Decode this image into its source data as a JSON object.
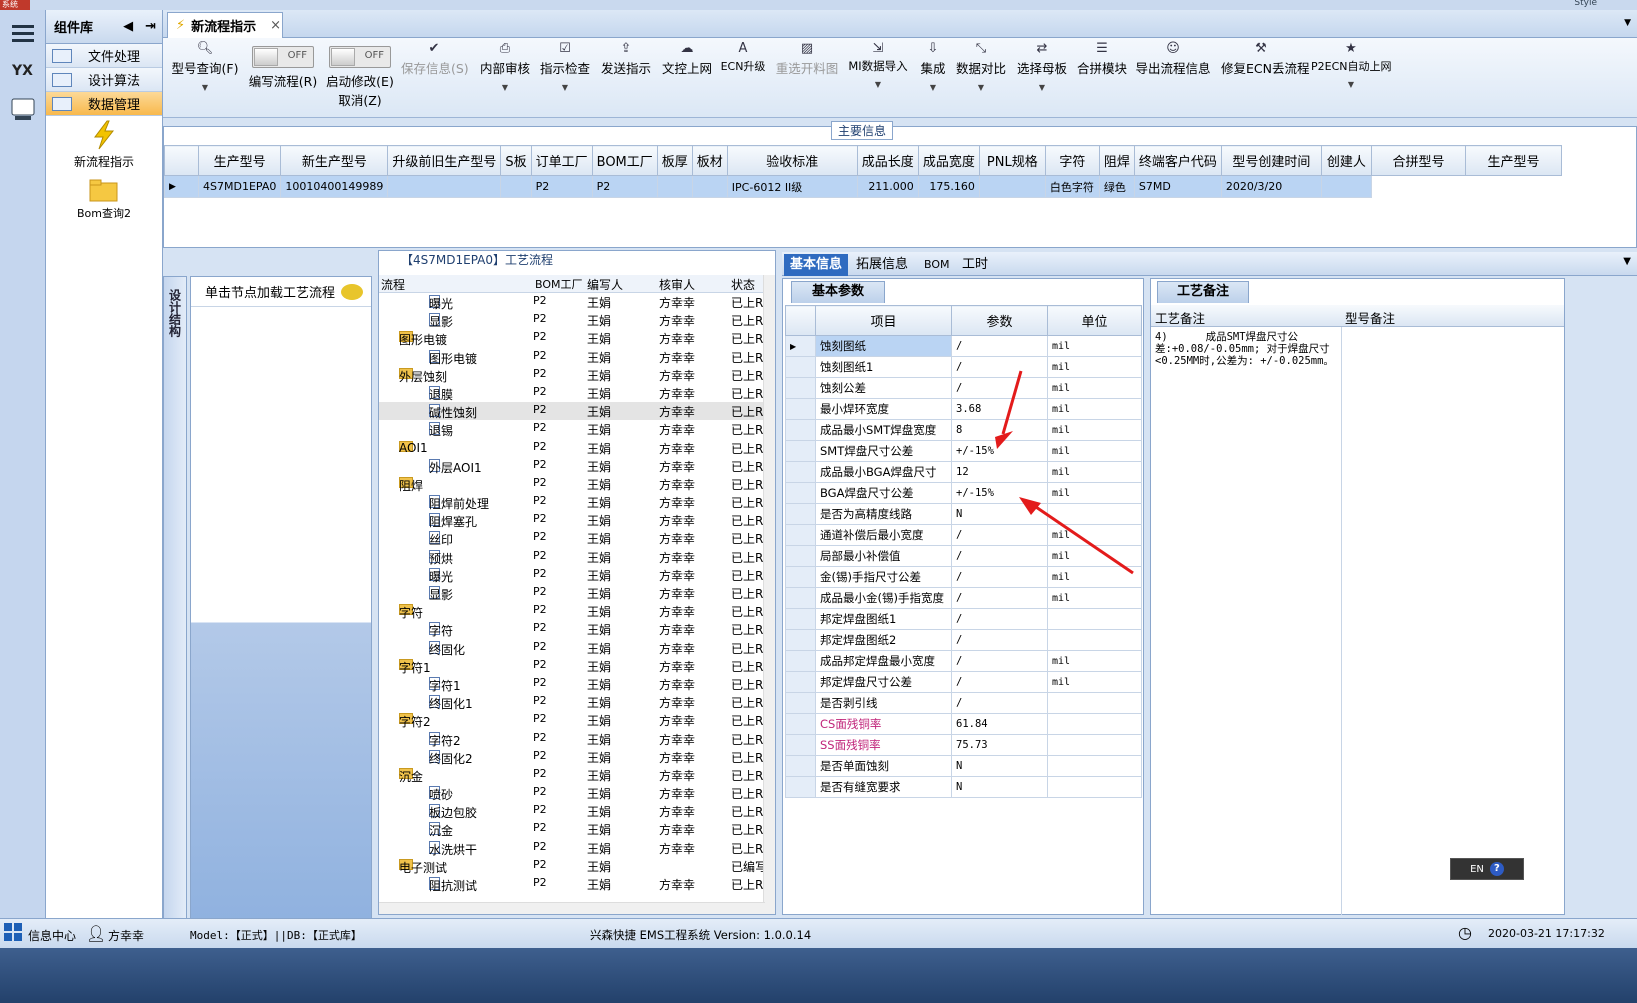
{
  "app": {
    "corner_tag": "系统",
    "style_label": "Style"
  },
  "component_panel": {
    "title": "组件库",
    "buttons": [
      "文件处理",
      "设计算法",
      "数据管理"
    ],
    "items": [
      "新流程指示",
      "Bom查询2"
    ]
  },
  "tab": {
    "label": "新流程指示",
    "close": "×"
  },
  "toolbar": {
    "items": [
      "型号查询(F)",
      "编写流程(R)",
      "启动修改(E)",
      "取消(Z)",
      "保存信息(S)",
      "内部审核",
      "指示检查",
      "发送指示",
      "文控上网",
      "ECN升级",
      "重选开料图",
      "MI数据导入",
      "集成",
      "数据对比",
      "选择母板",
      "合拼模块",
      "导出流程信息",
      "修复ECN丢流程",
      "P2ECN自动上网"
    ],
    "toggle_off": "OFF"
  },
  "main_info": {
    "title": "主要信息",
    "columns": [
      "生产型号",
      "新生产型号",
      "升级前旧生产型号",
      "S板",
      "订单工厂",
      "BOM工厂",
      "板厚",
      "板材",
      "验收标准",
      "成品长度",
      "成品宽度",
      "PNL规格",
      "字符",
      "阻焊",
      "终端客户代码",
      "型号创建时间",
      "创建人"
    ],
    "row": [
      "4S7MD1EPA0",
      "10010400149989",
      "",
      "",
      "P2",
      "P2",
      "",
      "",
      "IPC-6012 II级",
      "211.000",
      "175.160",
      "",
      "白色字符",
      "绿色",
      "S7MD",
      "2020/3/20",
      ""
    ],
    "right_columns": [
      "合拼型号",
      "生产型号"
    ]
  },
  "side_tab": "设计结构",
  "node_panel": {
    "hint": "单击节点加载工艺流程"
  },
  "process": {
    "title": "【4S7MD1EPA0】工艺流程",
    "columns": [
      "流程",
      "BOM工厂",
      "编写人",
      "核审人",
      "状态"
    ],
    "rows": [
      {
        "name": "曝光",
        "type": "doc",
        "lvl": 2,
        "bom": "P2",
        "w": "王娟",
        "r": "方幸幸",
        "s": "已上R"
      },
      {
        "name": "显影",
        "type": "doc",
        "lvl": 2,
        "bom": "P2",
        "w": "王娟",
        "r": "方幸幸",
        "s": "已上R"
      },
      {
        "name": "图形电镀",
        "type": "fold",
        "lvl": 1,
        "bom": "P2",
        "w": "王娟",
        "r": "方幸幸",
        "s": "已上R"
      },
      {
        "name": "图形电镀",
        "type": "doc",
        "lvl": 2,
        "bom": "P2",
        "w": "王娟",
        "r": "方幸幸",
        "s": "已上R"
      },
      {
        "name": "外层蚀刻",
        "type": "fold",
        "lvl": 1,
        "bom": "P2",
        "w": "王娟",
        "r": "方幸幸",
        "s": "已上R"
      },
      {
        "name": "退膜",
        "type": "doc",
        "lvl": 2,
        "bom": "P2",
        "w": "王娟",
        "r": "方幸幸",
        "s": "已上R"
      },
      {
        "name": "碱性蚀刻",
        "type": "doc",
        "lvl": 2,
        "bom": "P2",
        "w": "王娟",
        "r": "方幸幸",
        "s": "已上R",
        "sel": true
      },
      {
        "name": "退锡",
        "type": "doc",
        "lvl": 2,
        "bom": "P2",
        "w": "王娟",
        "r": "方幸幸",
        "s": "已上R"
      },
      {
        "name": "AOI1",
        "type": "fold",
        "lvl": 1,
        "bom": "P2",
        "w": "王娟",
        "r": "方幸幸",
        "s": "已上R"
      },
      {
        "name": "外层AOI1",
        "type": "doc",
        "lvl": 2,
        "bom": "P2",
        "w": "王娟",
        "r": "方幸幸",
        "s": "已上R"
      },
      {
        "name": "阻焊",
        "type": "fold",
        "lvl": 1,
        "bom": "P2",
        "w": "王娟",
        "r": "方幸幸",
        "s": "已上R"
      },
      {
        "name": "阻焊前处理",
        "type": "doc",
        "lvl": 2,
        "bom": "P2",
        "w": "王娟",
        "r": "方幸幸",
        "s": "已上R"
      },
      {
        "name": "阻焊塞孔",
        "type": "doc",
        "lvl": 2,
        "bom": "P2",
        "w": "王娟",
        "r": "方幸幸",
        "s": "已上R"
      },
      {
        "name": "丝印",
        "type": "doc",
        "lvl": 2,
        "bom": "P2",
        "w": "王娟",
        "r": "方幸幸",
        "s": "已上R"
      },
      {
        "name": "预烘",
        "type": "doc",
        "lvl": 2,
        "bom": "P2",
        "w": "王娟",
        "r": "方幸幸",
        "s": "已上R"
      },
      {
        "name": "曝光",
        "type": "doc",
        "lvl": 2,
        "bom": "P2",
        "w": "王娟",
        "r": "方幸幸",
        "s": "已上R"
      },
      {
        "name": "显影",
        "type": "doc",
        "lvl": 2,
        "bom": "P2",
        "w": "王娟",
        "r": "方幸幸",
        "s": "已上R"
      },
      {
        "name": "字符",
        "type": "fold",
        "lvl": 1,
        "bom": "P2",
        "w": "王娟",
        "r": "方幸幸",
        "s": "已上R"
      },
      {
        "name": "字符",
        "type": "doc",
        "lvl": 2,
        "bom": "P2",
        "w": "王娟",
        "r": "方幸幸",
        "s": "已上R"
      },
      {
        "name": "终固化",
        "type": "doc",
        "lvl": 2,
        "bom": "P2",
        "w": "王娟",
        "r": "方幸幸",
        "s": "已上R"
      },
      {
        "name": "字符1",
        "type": "fold",
        "lvl": 1,
        "bom": "P2",
        "w": "王娟",
        "r": "方幸幸",
        "s": "已上R"
      },
      {
        "name": "字符1",
        "type": "doc",
        "lvl": 2,
        "bom": "P2",
        "w": "王娟",
        "r": "方幸幸",
        "s": "已上R"
      },
      {
        "name": "终固化1",
        "type": "doc",
        "lvl": 2,
        "bom": "P2",
        "w": "王娟",
        "r": "方幸幸",
        "s": "已上R"
      },
      {
        "name": "字符2",
        "type": "fold",
        "lvl": 1,
        "bom": "P2",
        "w": "王娟",
        "r": "方幸幸",
        "s": "已上R"
      },
      {
        "name": "字符2",
        "type": "doc",
        "lvl": 2,
        "bom": "P2",
        "w": "王娟",
        "r": "方幸幸",
        "s": "已上R"
      },
      {
        "name": "终固化2",
        "type": "doc",
        "lvl": 2,
        "bom": "P2",
        "w": "王娟",
        "r": "方幸幸",
        "s": "已上R"
      },
      {
        "name": "沉金",
        "type": "fold",
        "lvl": 1,
        "bom": "P2",
        "w": "王娟",
        "r": "方幸幸",
        "s": "已上R"
      },
      {
        "name": "喷砂",
        "type": "doc",
        "lvl": 2,
        "bom": "P2",
        "w": "王娟",
        "r": "方幸幸",
        "s": "已上R"
      },
      {
        "name": "板边包胶",
        "type": "doc",
        "lvl": 2,
        "bom": "P2",
        "w": "王娟",
        "r": "方幸幸",
        "s": "已上R"
      },
      {
        "name": "沉金",
        "type": "doc",
        "lvl": 2,
        "bom": "P2",
        "w": "王娟",
        "r": "方幸幸",
        "s": "已上R"
      },
      {
        "name": "水洗烘干",
        "type": "doc",
        "lvl": 2,
        "bom": "P2",
        "w": "王娟",
        "r": "方幸幸",
        "s": "已上R"
      },
      {
        "name": "电子测试",
        "type": "fold",
        "lvl": 1,
        "bom": "P2",
        "w": "王娟",
        "r": "",
        "s": "已编写"
      },
      {
        "name": "阻抗测试",
        "type": "doc",
        "lvl": 2,
        "bom": "P2",
        "w": "王娟",
        "r": "方幸幸",
        "s": "已上R"
      }
    ]
  },
  "right_tabs": [
    "基本信息",
    "拓展信息",
    "BOM",
    "工时"
  ],
  "basic_params": {
    "title": "基本参数",
    "columns": [
      "项目",
      "参数",
      "单位"
    ],
    "rows": [
      [
        "蚀刻图纸",
        "/",
        "mil"
      ],
      [
        "蚀刻图纸1",
        "/",
        "mil"
      ],
      [
        "蚀刻公差",
        "/",
        "mil"
      ],
      [
        "最小焊环宽度",
        "3.68",
        "mil"
      ],
      [
        "成品最小SMT焊盘宽度",
        "8",
        "mil"
      ],
      [
        "SMT焊盘尺寸公差",
        "+/-15%",
        "mil"
      ],
      [
        "成品最小BGA焊盘尺寸",
        "12",
        "mil"
      ],
      [
        "BGA焊盘尺寸公差",
        "+/-15%",
        "mil"
      ],
      [
        "是否为高精度线路",
        "N",
        ""
      ],
      [
        "通道补偿后最小宽度",
        "/",
        "mil"
      ],
      [
        "局部最小补偿值",
        "/",
        "mil"
      ],
      [
        "金(锡)手指尺寸公差",
        "/",
        "mil"
      ],
      [
        "成品最小金(锡)手指宽度",
        "/",
        "mil"
      ],
      [
        "邦定焊盘图纸1",
        "/",
        ""
      ],
      [
        "邦定焊盘图纸2",
        "/",
        ""
      ],
      [
        "成品邦定焊盘最小宽度",
        "/",
        "mil"
      ],
      [
        "邦定焊盘尺寸公差",
        "/",
        "mil"
      ],
      [
        "是否剥引线",
        "/",
        ""
      ],
      [
        "CS面残铜率",
        "61.84",
        ""
      ],
      [
        "SS面残铜率",
        "75.73",
        ""
      ],
      [
        "是否单面蚀刻",
        "N",
        ""
      ],
      [
        "是否有缝宽要求",
        "N",
        ""
      ]
    ],
    "pink_rows": [
      18,
      19
    ]
  },
  "notes": {
    "title": "工艺备注",
    "columns": [
      "工艺备注",
      "型号备注"
    ],
    "text": "4)      成品SMT焊盘尺寸公差:+0.08/-0.05mm; 对于焊盘尺寸<0.25MM时,公差为: +/-0.025mm。"
  },
  "lang": "EN",
  "status": {
    "info_center": "信息中心",
    "user": "方幸幸",
    "model": "Model:【正式】||DB:【正式库】",
    "system": "兴森快捷 EMS工程系统 Version: 1.0.0.14",
    "datetime": "2020-03-21 17:17:32"
  },
  "colors": {
    "accent": "#2f6bc0",
    "selected": "#bad4f3",
    "annotation_arrow": "#e31b1b"
  }
}
